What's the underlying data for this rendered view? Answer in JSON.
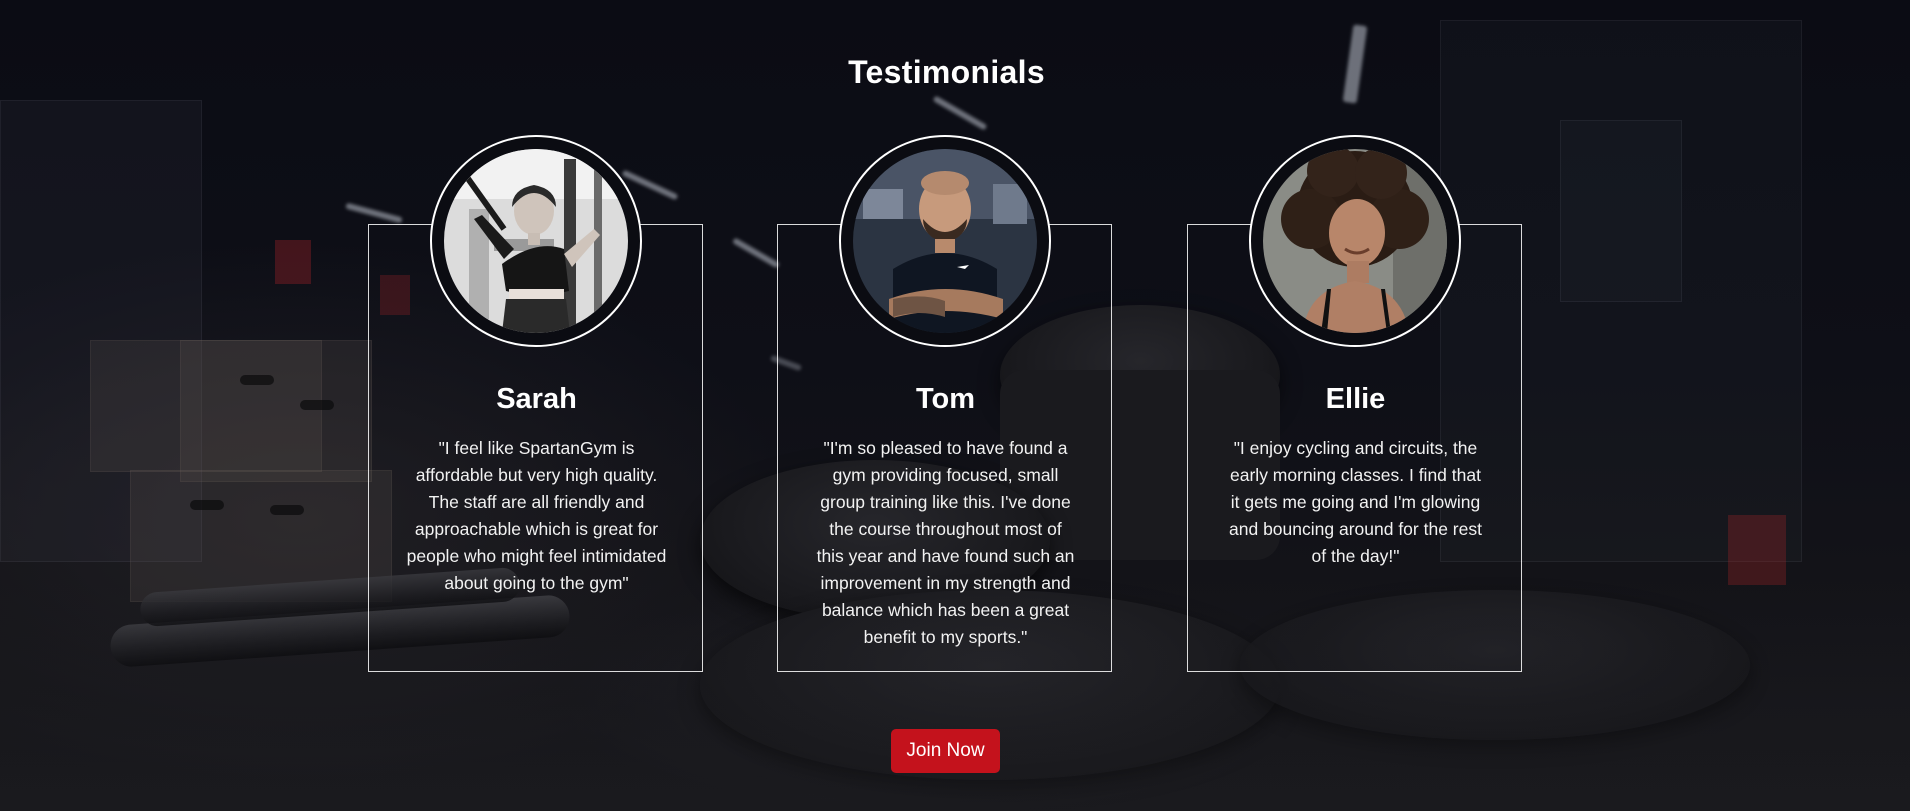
{
  "section": {
    "title": "Testimonials"
  },
  "testimonials": [
    {
      "name": "Sarah",
      "quote": "\"I feel like SpartanGym is affordable but very high quality. The staff are all friendly and approachable which is great for people who might feel intimidated about going to the gym\""
    },
    {
      "name": "Tom",
      "quote": "\"I'm so pleased to have found a gym providing focused, small group training like this. I've done the course throughout most of this year and have found such an improvement in my strength and balance which has been a great benefit to my sports.\""
    },
    {
      "name": "Ellie",
      "quote": "\"I enjoy cycling and circuits, the early morning classes. I find that it gets me going and I'm glowing and bouncing around for the rest of the day!\""
    }
  ],
  "cta": {
    "label": "Join Now"
  },
  "colors": {
    "accent": "#c4121c",
    "background": "#0e0f17",
    "text": "#ffffff"
  }
}
